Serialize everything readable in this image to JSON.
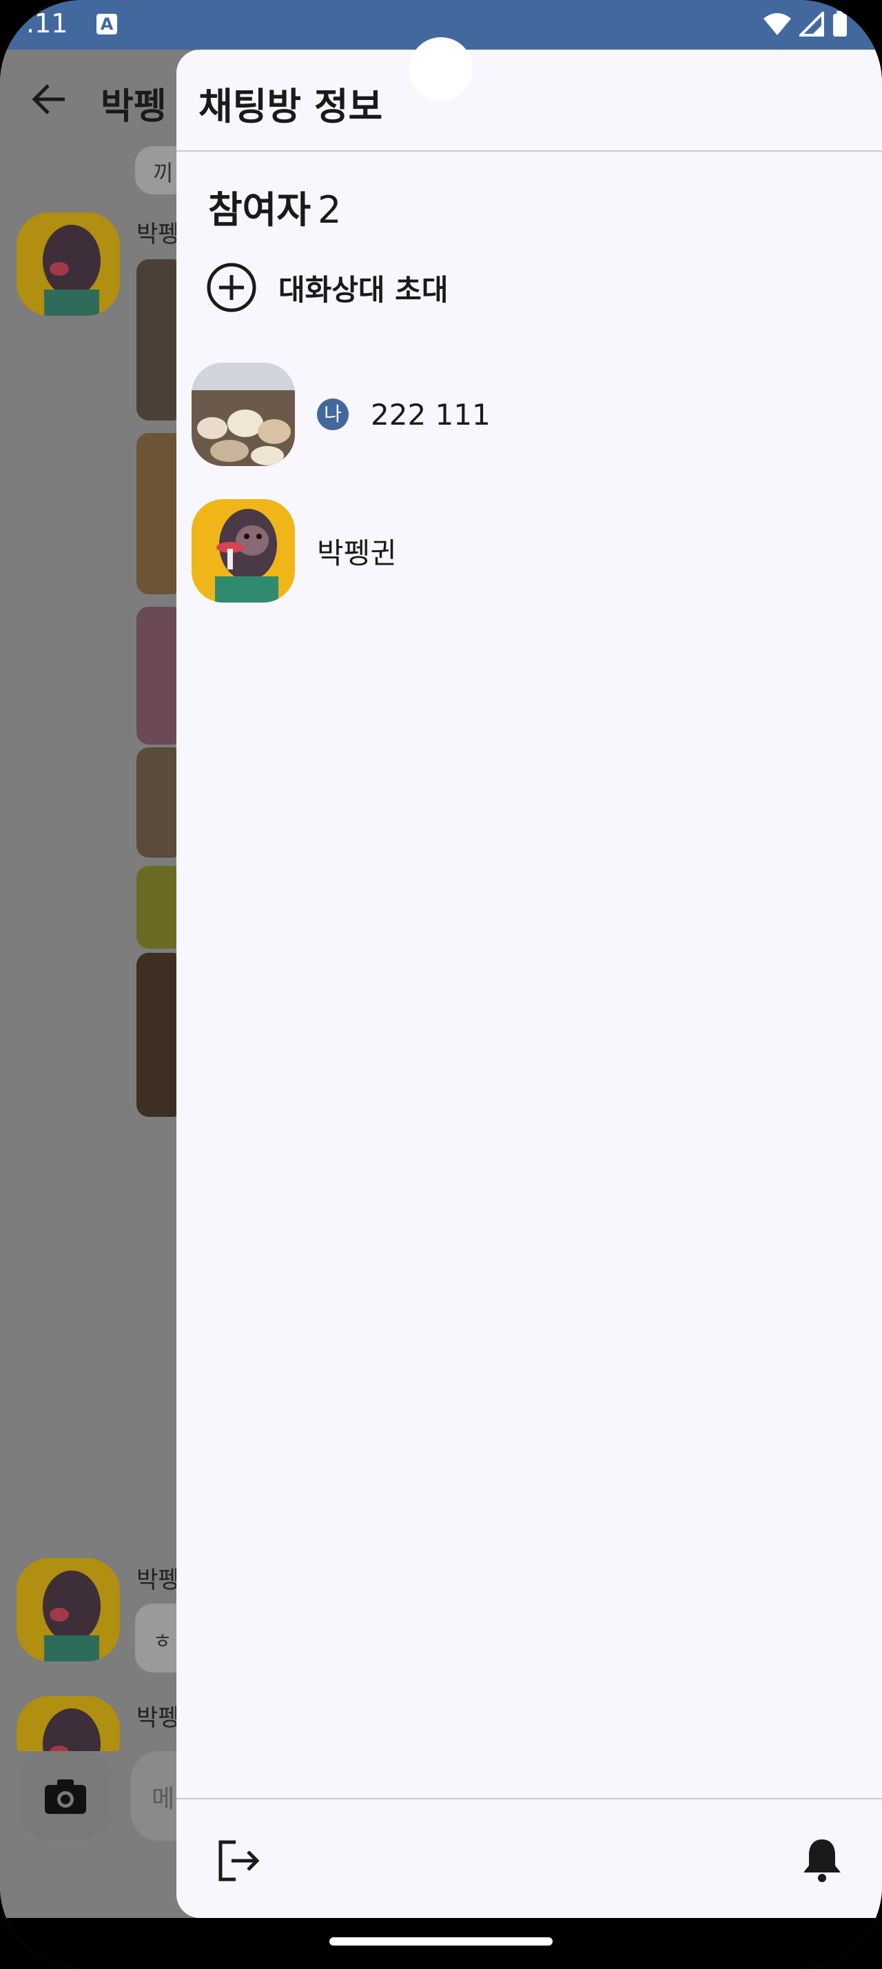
{
  "status_bar": {
    "time": ".11",
    "notification_icon": "A"
  },
  "background_chat": {
    "title": "박펭",
    "input_placeholder": "메",
    "sender_name": "박펭",
    "snippet_1": "끼",
    "snippet_2": "ㅎ"
  },
  "drawer": {
    "title": "채팅방 정보",
    "participants_label": "참여자",
    "participants_count": "2",
    "invite_label": "대화상대 초대",
    "participants": [
      {
        "me_badge": "나",
        "name": "222 111"
      },
      {
        "name": "박펭귄"
      }
    ]
  },
  "colors": {
    "accent": "#43689e",
    "drawer_bg": "#f8f7fe",
    "scrim": "#7d7d7d"
  }
}
